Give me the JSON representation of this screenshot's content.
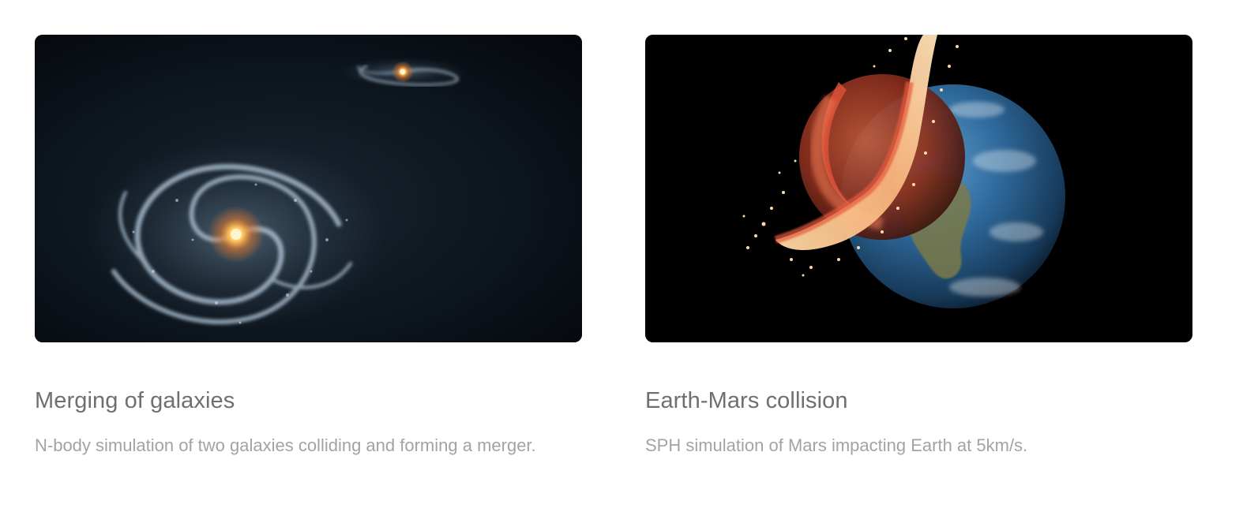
{
  "cards": [
    {
      "title": "Merging of galaxies",
      "description": "N-body simulation of two galaxies colliding and forming a merger.",
      "image": "galaxy-merger-image"
    },
    {
      "title": "Earth-Mars collision",
      "description": "SPH simulation of Mars impacting Earth at 5km/s.",
      "image": "earth-mars-impact-image"
    }
  ],
  "colors": {
    "title": "#6f6f6f",
    "description": "#a3a3a3",
    "space_dark": "#0b121a",
    "galaxy_core": "#ffb347",
    "impact_red": "#d8442c",
    "ocean_blue": "#2f6a9c"
  }
}
